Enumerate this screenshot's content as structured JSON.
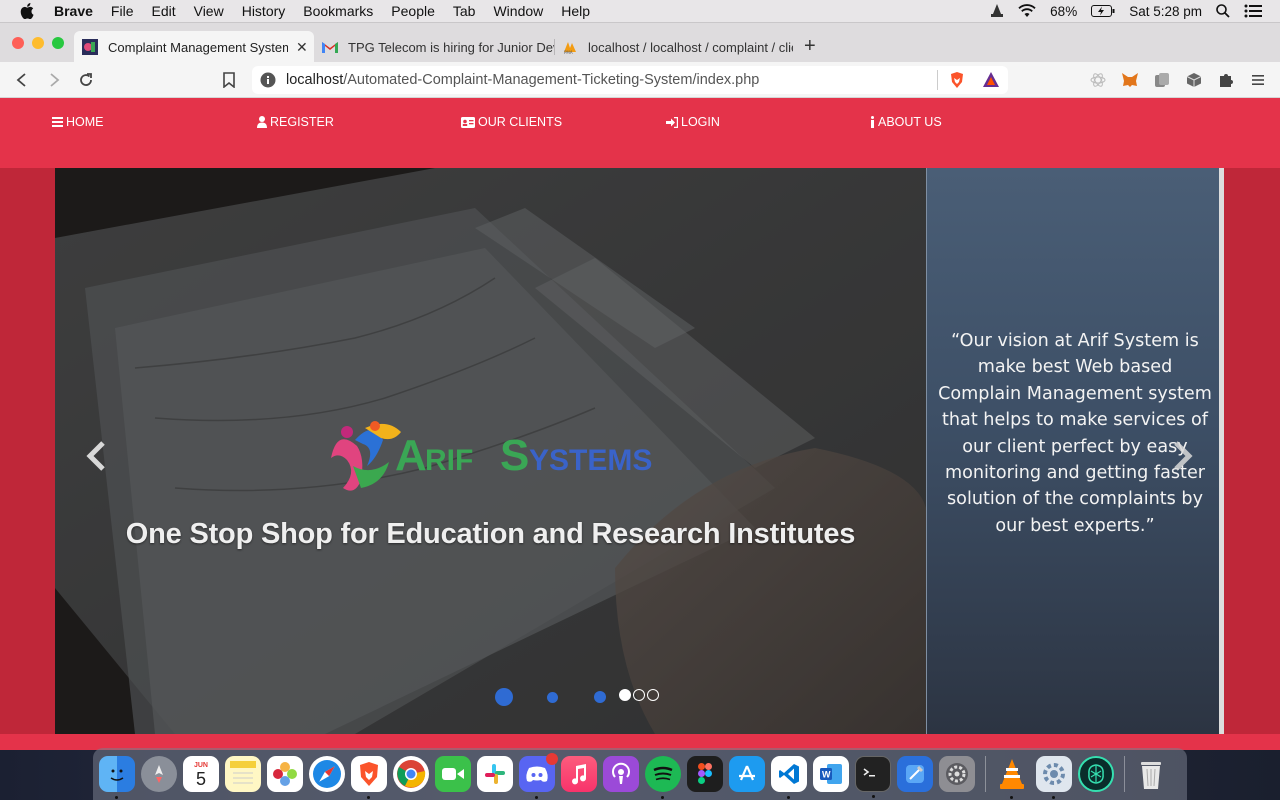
{
  "menubar": {
    "app_name": "Brave",
    "items": [
      "File",
      "Edit",
      "View",
      "History",
      "Bookmarks",
      "People",
      "Tab",
      "Window",
      "Help"
    ],
    "battery": "68%",
    "clock": "Sat 5:28 pm"
  },
  "tabs": [
    {
      "title": "Complaint Management System",
      "active": true
    },
    {
      "title": "TPG Telecom is hiring for Junior Developer",
      "active": false
    },
    {
      "title": "localhost / localhost / complaint / clients",
      "active": false
    }
  ],
  "toolbar": {
    "url_host": "localhost",
    "url_path": "/Automated-Complaint-Management-Ticketing-System/index.php"
  },
  "site": {
    "nav": [
      {
        "label": "HOME",
        "icon": "bars-icon"
      },
      {
        "label": "REGISTER",
        "icon": "user-icon"
      },
      {
        "label": "OUR CLIENTS",
        "icon": "id-card-icon"
      },
      {
        "label": "LOGIN",
        "icon": "sign-in-icon"
      },
      {
        "label": "ABOUT US",
        "icon": "info-icon"
      }
    ],
    "logo_text": "ArifSystems",
    "tagline": "One Stop Shop for Education and Research Institutes",
    "quote": "“Our vision at Arif System is make best Web based Complain Management system that helps to make services of our client perfect by easy monitoring and getting faster solution of the complaints by our best experts.”",
    "slide_count": 3,
    "active_slide": 1
  },
  "colors": {
    "nav_red": "#e4334a",
    "band_red": "#bf2739",
    "panel_blue": "#3d4f66",
    "dot_blue": "#2f6bd3"
  },
  "dock": {
    "apps": [
      "finder-icon",
      "launchpad-icon",
      "calendar-icon",
      "notes-icon",
      "photos-icon",
      "safari-icon",
      "brave-icon",
      "chrome-icon",
      "facetime-icon",
      "slack-icon",
      "discord-icon",
      "music-icon",
      "podcasts-icon",
      "spotify-icon",
      "figma-icon",
      "app-store-icon",
      "vscode-icon",
      "word-icon",
      "terminal-icon",
      "xcode-icon",
      "system-preferences-icon",
      "vlc-icon",
      "utility-icon",
      "ai-icon",
      "trash-icon"
    ],
    "calendar_day": "5",
    "calendar_month": "JUN"
  }
}
